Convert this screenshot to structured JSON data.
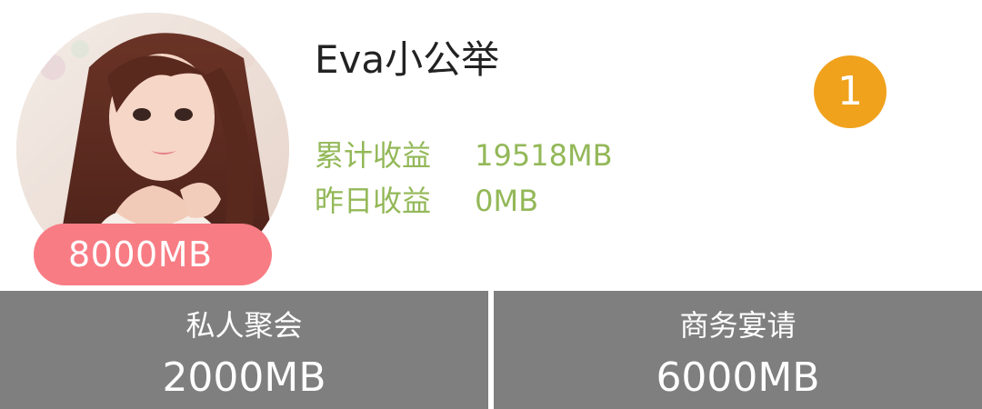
{
  "profile": {
    "name": "Eva小公举",
    "price": "8000MB",
    "rank": "1"
  },
  "stats": [
    {
      "label": "累计收益",
      "value": "19518MB"
    },
    {
      "label": "昨日收益",
      "value": "0MB"
    }
  ],
  "services": [
    {
      "name": "私人聚会",
      "price": "2000MB"
    },
    {
      "name": "商务宴请",
      "price": "6000MB"
    }
  ],
  "colors": {
    "price_badge": "#f87c84",
    "stats_text": "#93b858",
    "rank_badge": "#f0a21d",
    "service_bg": "#7f7f7f"
  }
}
